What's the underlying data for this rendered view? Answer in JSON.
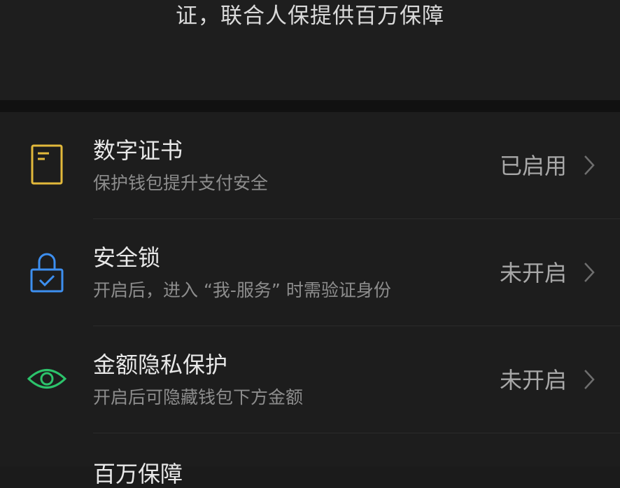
{
  "banner": {
    "text": "证，联合人保提供百万保障"
  },
  "settings": [
    {
      "icon": "certificate-icon",
      "title": "数字证书",
      "subtitle": "保护钱包提升支付安全",
      "status": "已启用"
    },
    {
      "icon": "lock-icon",
      "title": "安全锁",
      "subtitle": "开启后，进入 “我-服务” 时需验证身份",
      "status": "未开启"
    },
    {
      "icon": "eye-icon",
      "title": "金额隐私保护",
      "subtitle": "开启后可隐藏钱包下方金额",
      "status": "未开启"
    },
    {
      "title": "百万保障"
    }
  ],
  "colors": {
    "certificate_icon": "#e2b93b",
    "lock_icon": "#3d8ff0",
    "eye_icon": "#2cc36b",
    "background": "#1b1b1b"
  }
}
